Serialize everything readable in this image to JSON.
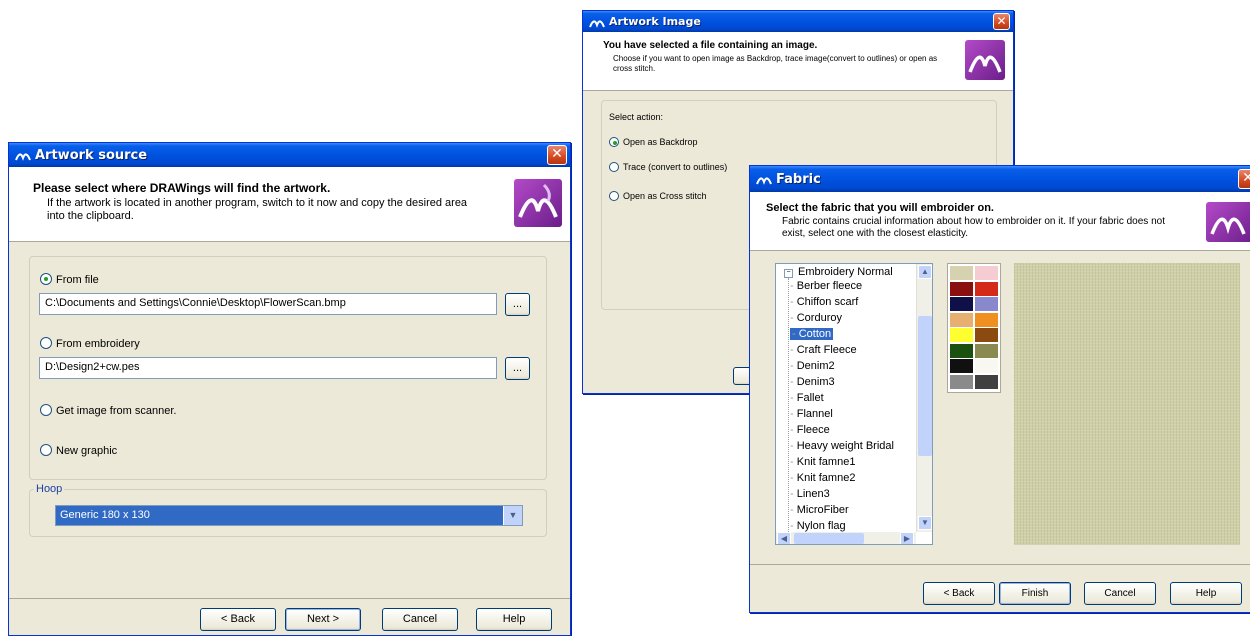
{
  "artwork_source": {
    "title": "Artwork source",
    "header_title": "Please select where DRAWings will find the artwork.",
    "header_desc": "If the artwork is located in another program, switch to it now and copy the desired area into the clipboard.",
    "from_file_label": "From file",
    "from_file_value": "C:\\Documents and Settings\\Connie\\Desktop\\FlowerScan.bmp",
    "browse_label": "...",
    "from_embroidery_label": "From embroidery",
    "from_embroidery_value": "D:\\Design2+cw.pes",
    "scanner_label": "Get image from scanner.",
    "new_graphic_label": "New graphic",
    "hoop_label": "Hoop",
    "hoop_value": "Generic 180 x 130",
    "back_label": "< Back",
    "next_label": "Next >",
    "cancel_label": "Cancel",
    "help_label": "Help",
    "selected": "from_file"
  },
  "artwork_image": {
    "title": "Artwork Image",
    "header_title": "You have selected a file containing an image.",
    "header_desc": "Choose if you want to open image as Backdrop, trace image(convert to outlines) or open as cross stitch.",
    "select_action_label": "Select action:",
    "opt_backdrop": "Open as Backdrop",
    "opt_trace": "Trace (convert to outlines)",
    "opt_cross": "Open as Cross stitch",
    "selected": "backdrop"
  },
  "fabric": {
    "title": "Fabric",
    "header_title": "Select the fabric that you will embroider on.",
    "header_desc": "Fabric contains crucial information about how to embroider on it. If your fabric does not exist, select one with the closest elasticity.",
    "tree_root": "Embroidery Normal",
    "items": [
      "Berber fleece",
      "Chiffon scarf",
      "Corduroy",
      "Cotton",
      "Craft Fleece",
      "Denim2",
      "Denim3",
      "Fallet",
      "Flannel",
      "Fleece",
      "Heavy weight Bridal",
      "Knit famne1",
      "Knit famne2",
      "Linen3",
      "MicroFiber",
      "Nylon flag"
    ],
    "selected_item": "Cotton",
    "swatches": [
      "#d6d2b0",
      "#f5ccd2",
      "#8a1010",
      "#d42a1a",
      "#101048",
      "#8888cc",
      "#e8b070",
      "#f09020",
      "#ffff30",
      "#8a4a10",
      "#1a5010",
      "#8a8a50",
      "#101010",
      "#f8f8f0",
      "#8a8a8a",
      "#404040"
    ],
    "back_label": "< Back",
    "finish_label": "Finish",
    "cancel_label": "Cancel",
    "help_label": "Help"
  }
}
